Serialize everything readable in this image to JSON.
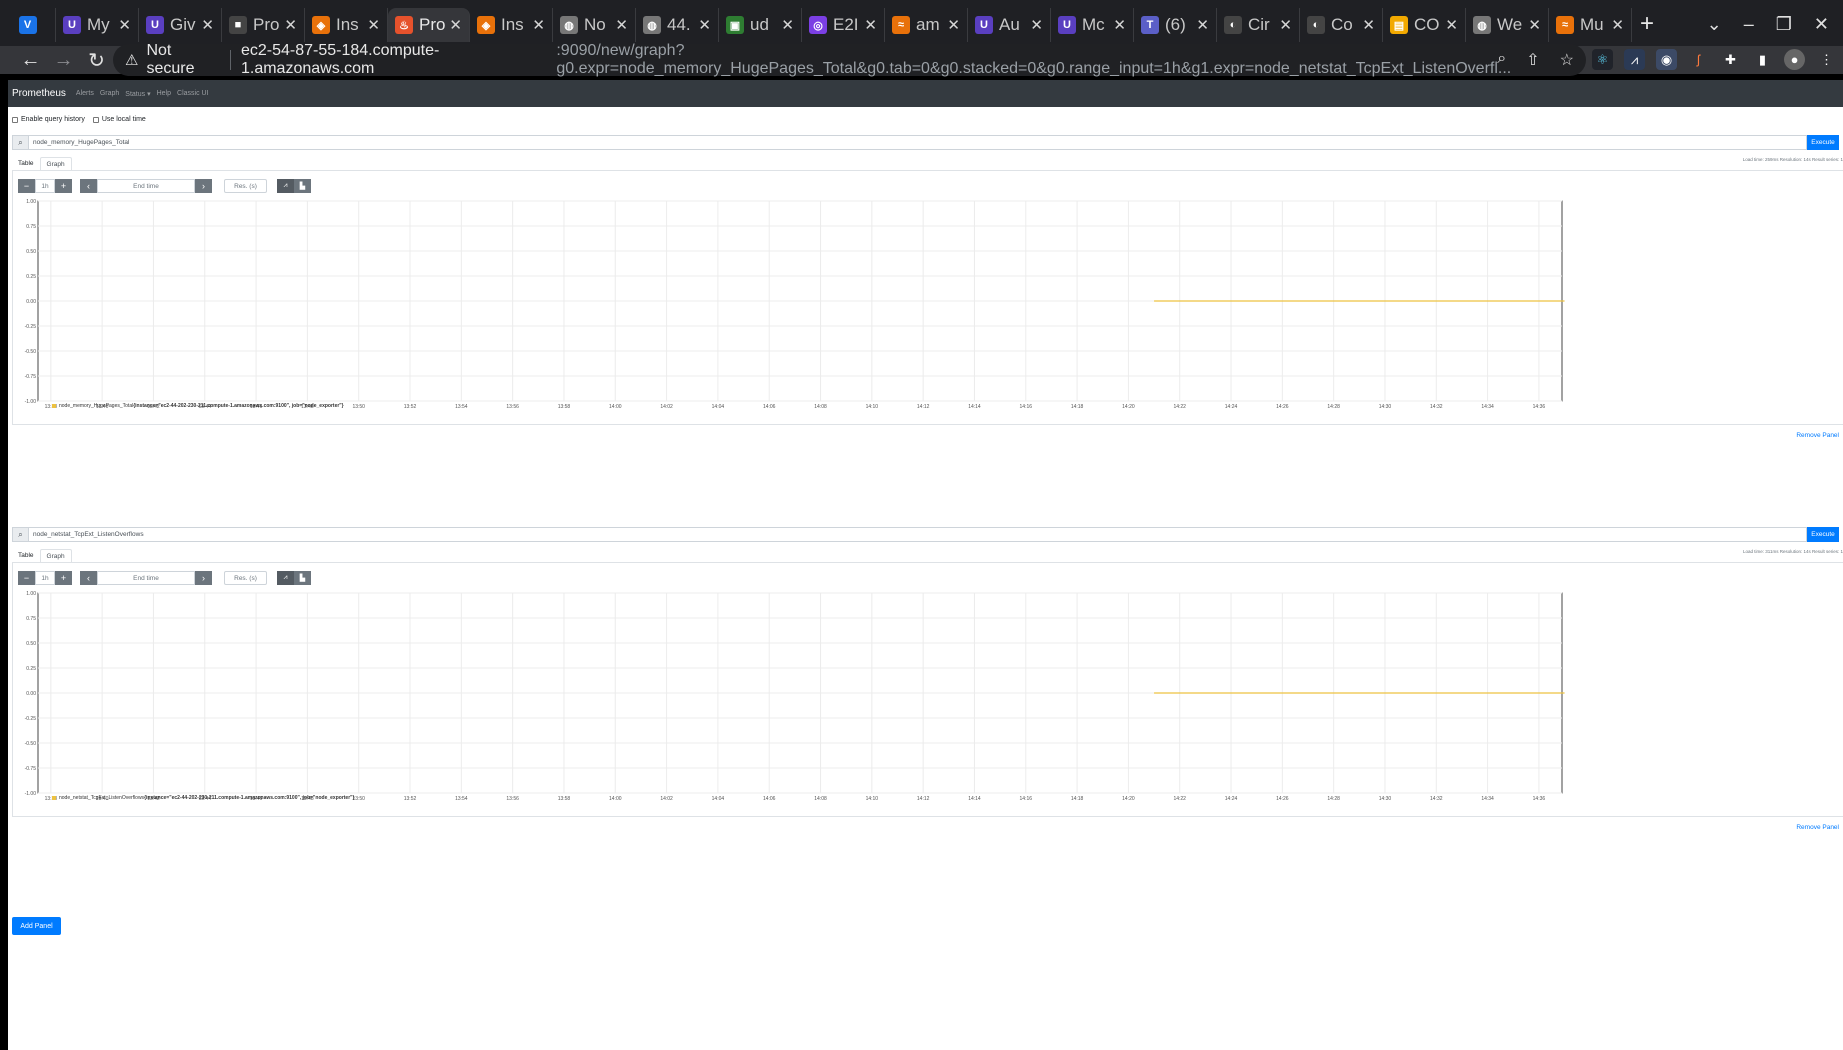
{
  "browser": {
    "tabs": [
      {
        "title": "",
        "color": "#1a73e8",
        "glyph": "V"
      },
      {
        "title": "My",
        "color": "#5a3fc0",
        "glyph": "U"
      },
      {
        "title": "Giv",
        "color": "#5a3fc0",
        "glyph": "U"
      },
      {
        "title": "Pro",
        "color": "#444",
        "glyph": "■"
      },
      {
        "title": "Ins",
        "color": "#e8710a",
        "glyph": "◈"
      },
      {
        "title": "Pro",
        "color": "#e6522c",
        "glyph": "♨",
        "active": true
      },
      {
        "title": "Ins",
        "color": "#e8710a",
        "glyph": "◈"
      },
      {
        "title": "No",
        "color": "#777",
        "glyph": "◍"
      },
      {
        "title": "44.",
        "color": "#777",
        "glyph": "◍"
      },
      {
        "title": "ud",
        "color": "#2e7d32",
        "glyph": "▣"
      },
      {
        "title": "E2I",
        "color": "#7b3fe4",
        "glyph": "◎"
      },
      {
        "title": "am",
        "color": "#e8710a",
        "glyph": "≈"
      },
      {
        "title": "Au",
        "color": "#5a3fc0",
        "glyph": "U"
      },
      {
        "title": "Mc",
        "color": "#5a3fc0",
        "glyph": "U"
      },
      {
        "title": "(6)",
        "color": "#5b5fc7",
        "glyph": "T"
      },
      {
        "title": "Cir",
        "color": "#444",
        "glyph": "◐"
      },
      {
        "title": "Co",
        "color": "#444",
        "glyph": "◐"
      },
      {
        "title": "CO",
        "color": "#f2a900",
        "glyph": "▤"
      },
      {
        "title": "We",
        "color": "#777",
        "glyph": "◍"
      },
      {
        "title": "Mu",
        "color": "#e8710a",
        "glyph": "≈"
      }
    ],
    "url_security": "Not secure",
    "url_host": "ec2-54-87-55-184.compute-1.amazonaws.com",
    "url_rest": ":9090/new/graph?g0.expr=node_memory_HugePages_Total&g0.tab=0&g0.stacked=0&g0.range_input=1h&g1.expr=node_netstat_TcpExt_ListenOverfl...",
    "new_tab": "+"
  },
  "app": {
    "brand": "Prometheus",
    "nav": [
      "Alerts",
      "Graph",
      "Status ▾",
      "Help",
      "Classic UI"
    ],
    "options": {
      "query_history": "Enable query history",
      "local_time": "Use local time"
    },
    "add_panel": "Add Panel"
  },
  "panels": [
    {
      "query": "node_memory_HugePages_Total",
      "execute": "Execute",
      "stats": "Load time: 259ms   Resolution: 14s   Result series: 1",
      "tabs": [
        "Table",
        "Graph"
      ],
      "range": "1h",
      "end_time_placeholder": "End time",
      "res_placeholder": "Res. (s)",
      "legend_metric": "node_memory_HugePages_Total",
      "legend_labels": "{instance=\"ec2-44-202-230-211.compute-1.amazonaws.com:9100\", job=\"node_exporter\"}",
      "remove": "Remove Panel"
    },
    {
      "query": "node_netstat_TcpExt_ListenOverflows",
      "execute": "Execute",
      "stats": "Load time: 311ms   Resolution: 14s   Result series: 1",
      "tabs": [
        "Table",
        "Graph"
      ],
      "range": "1h",
      "end_time_placeholder": "End time",
      "res_placeholder": "Res. (s)",
      "legend_metric": "node_netstat_TcpExt_ListenOverflows",
      "legend_labels": "{instance=\"ec2-44-202-230-211.compute-1.amazonaws.com:9100\", job=\"node_exporter\"}",
      "remove": "Remove Panel"
    }
  ],
  "chart_data": [
    {
      "type": "line",
      "y_ticks": [
        "1.00",
        "0.75",
        "0.50",
        "0.25",
        "0.00",
        "-0.25",
        "-0.50",
        "-0.75",
        "-1.00"
      ],
      "ylim": [
        -1,
        1
      ],
      "x_ticks": [
        "13:38",
        "13:40",
        "13:42",
        "13:44",
        "13:46",
        "13:48",
        "13:50",
        "13:52",
        "13:54",
        "13:56",
        "13:58",
        "14:00",
        "14:02",
        "14:04",
        "14:06",
        "14:08",
        "14:10",
        "14:12",
        "14:14",
        "14:16",
        "14:18",
        "14:20",
        "14:22",
        "14:24",
        "14:26",
        "14:28",
        "14:30",
        "14:32",
        "14:34",
        "14:36"
      ],
      "grid": true,
      "series": [
        {
          "color": "#edc240",
          "x_start": "14:21",
          "x_end": "14:37",
          "value": 0
        }
      ]
    },
    {
      "type": "line",
      "y_ticks": [
        "1.00",
        "0.75",
        "0.50",
        "0.25",
        "0.00",
        "-0.25",
        "-0.50",
        "-0.75",
        "-1.00"
      ],
      "ylim": [
        -1,
        1
      ],
      "x_ticks": [
        "13:38",
        "13:40",
        "13:42",
        "13:44",
        "13:46",
        "13:48",
        "13:50",
        "13:52",
        "13:54",
        "13:56",
        "13:58",
        "14:00",
        "14:02",
        "14:04",
        "14:06",
        "14:08",
        "14:10",
        "14:12",
        "14:14",
        "14:16",
        "14:18",
        "14:20",
        "14:22",
        "14:24",
        "14:26",
        "14:28",
        "14:30",
        "14:32",
        "14:34",
        "14:36"
      ],
      "grid": true,
      "series": [
        {
          "color": "#edc240",
          "x_start": "14:21",
          "x_end": "14:37",
          "value": 0
        }
      ]
    }
  ]
}
